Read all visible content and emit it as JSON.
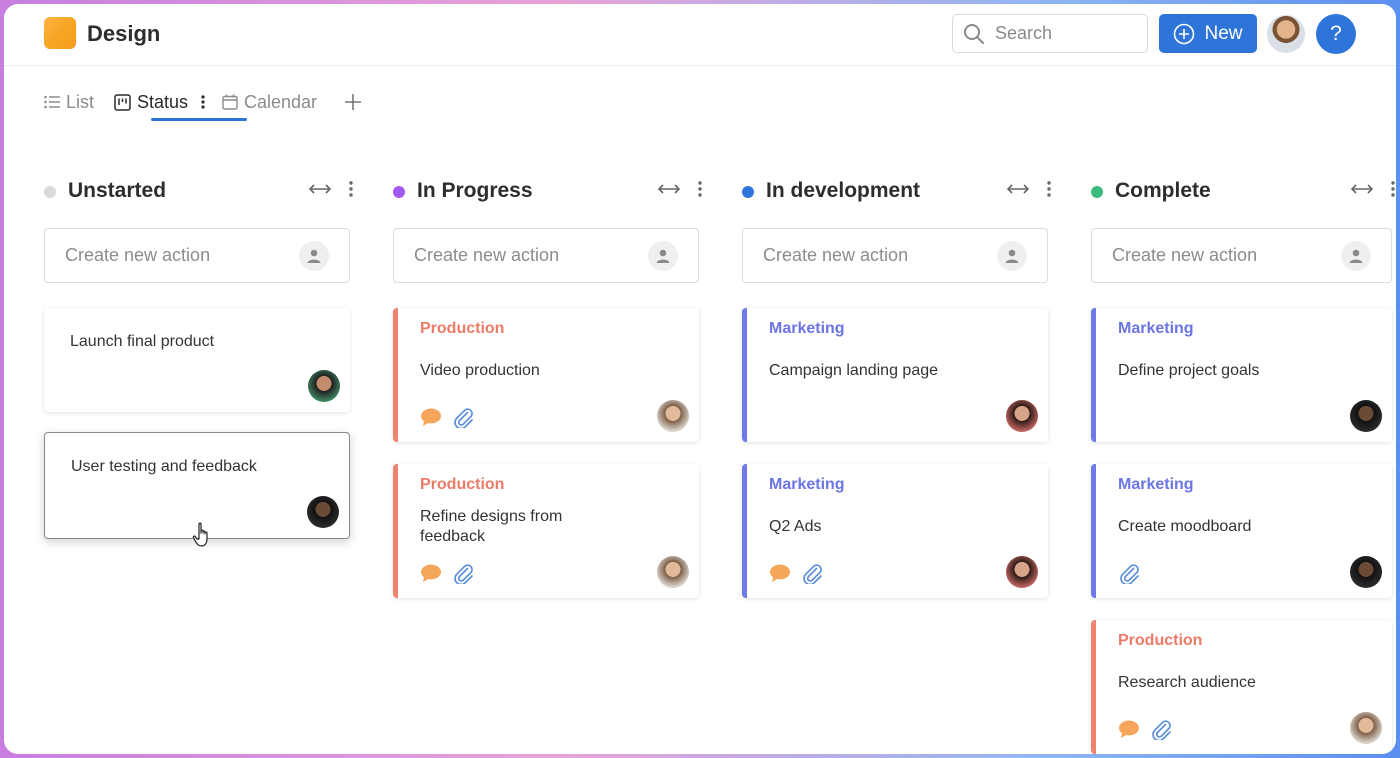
{
  "app": {
    "title": "Design"
  },
  "header": {
    "search_placeholder": "Search",
    "new_label": "New",
    "help_label": "?"
  },
  "tabs": [
    {
      "label": "List",
      "icon": "list-icon",
      "active": false
    },
    {
      "label": "Status",
      "icon": "board-icon",
      "active": true
    },
    {
      "label": "Calendar",
      "icon": "calendar-icon",
      "active": false
    }
  ],
  "create_placeholder": "Create new action",
  "columns": [
    {
      "title": "Unstarted",
      "dot_color": "#d9d9d9",
      "cards": [
        {
          "title": "Launch final product"
        },
        {
          "title": "User testing and feedback"
        }
      ]
    },
    {
      "title": "In Progress",
      "dot_color": "#a259f0",
      "cards": [
        {
          "category": "Production",
          "title": "Video production"
        },
        {
          "category": "Production",
          "title": "Refine designs from feedback"
        }
      ]
    },
    {
      "title": "In development",
      "dot_color": "#2f74d8",
      "cards": [
        {
          "category": "Marketing",
          "title": "Campaign landing page"
        },
        {
          "category": "Marketing",
          "title": "Q2 Ads"
        }
      ]
    },
    {
      "title": "Complete",
      "dot_color": "#3dbb7d",
      "cards": [
        {
          "category": "Marketing",
          "title": "Define project goals"
        },
        {
          "category": "Marketing",
          "title": "Create moodboard"
        },
        {
          "category": "Production",
          "title": "Research audience"
        }
      ]
    }
  ],
  "colors": {
    "accent": "#2f74d8",
    "production": "#f0836f",
    "marketing": "#6f7ae8",
    "comment": "#f5a65a",
    "attachment": "#5c8fd8"
  }
}
